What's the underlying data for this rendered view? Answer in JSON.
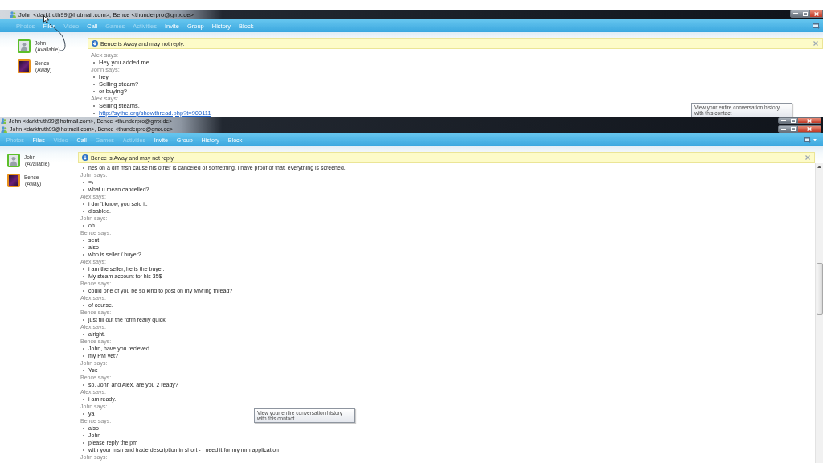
{
  "windows": [
    {
      "title": "John <darktruth99@hotmail.com>, Bence <thunderpro@gmx.de>",
      "toolbar": [
        {
          "label": "Photos",
          "disabled": true
        },
        {
          "label": "Files",
          "disabled": false
        },
        {
          "label": "Video",
          "disabled": true
        },
        {
          "label": "Call",
          "disabled": false
        },
        {
          "label": "Games",
          "disabled": true
        },
        {
          "label": "Activities",
          "disabled": true
        },
        {
          "label": "Invite",
          "disabled": false
        },
        {
          "label": "Group",
          "disabled": false
        },
        {
          "label": "History",
          "disabled": false
        },
        {
          "label": "Block",
          "disabled": false
        }
      ],
      "notice": "Bence is Away and may not reply.",
      "contacts": [
        {
          "name": "John",
          "status": "(Available)",
          "kind": "silhouette",
          "color": "#5cbf2a"
        },
        {
          "name": "Bence",
          "status": "(Away)",
          "kind": "photo",
          "color": "#e8901a"
        }
      ],
      "messages": [
        {
          "sender": "Alex says:",
          "lines": [
            "Hey you added me"
          ]
        },
        {
          "sender": "John says:",
          "lines": [
            "hey.",
            "Selling steam?",
            "or buying?"
          ]
        },
        {
          "sender": "Alex says:",
          "lines": [
            "Selling steams."
          ],
          "link": "http://sythe.org/showthread.php?t=900111"
        }
      ],
      "tooltip": "View your entire conversation history with this contact"
    },
    {
      "title": "John <darktruth99@hotmail.com>, Bence <thunderpro@gmx.de>"
    },
    {
      "title": "John <darktruth99@hotmail.com>, Bence <thunderpro@gmx.de>",
      "toolbar": [
        {
          "label": "Photos",
          "disabled": true
        },
        {
          "label": "Files",
          "disabled": false
        },
        {
          "label": "Video",
          "disabled": true
        },
        {
          "label": "Call",
          "disabled": false
        },
        {
          "label": "Games",
          "disabled": true
        },
        {
          "label": "Activities",
          "disabled": true
        },
        {
          "label": "Invite",
          "disabled": false
        },
        {
          "label": "Group",
          "disabled": false
        },
        {
          "label": "History",
          "disabled": false
        },
        {
          "label": "Block",
          "disabled": false
        }
      ],
      "menu_caret": true,
      "notice": "Bence is Away and may not reply.",
      "contacts": [
        {
          "name": "John",
          "status": "(Available)",
          "kind": "silhouette",
          "color": "#5cbf2a"
        },
        {
          "name": "Bence",
          "status": "(Away)",
          "kind": "photo",
          "color": "#e8901a"
        }
      ],
      "messages": [
        {
          "lines": [
            "hes on a diff msn cause his other is canceled or something, i have proof of that, everything is screened."
          ]
        },
        {
          "sender": "John says:",
          "lines": [
            "=\\",
            "what u mean cancelled?"
          ]
        },
        {
          "sender": "Alex says:",
          "lines": [
            "i don't know, you said it.",
            "disabled."
          ]
        },
        {
          "sender": "John says:",
          "lines": [
            "oh"
          ]
        },
        {
          "sender": "Bence says:",
          "lines": [
            "sent",
            "also",
            "who is seller / buyer?"
          ]
        },
        {
          "sender": "Alex says:",
          "lines": [
            "i am the seller, he is the buyer.",
            "My steam account for his 35$"
          ]
        },
        {
          "sender": "Bence says:",
          "lines": [
            "could one of you be so kind to post on my MM'ing thread?"
          ]
        },
        {
          "sender": "Alex says:",
          "lines": [
            "of course."
          ]
        },
        {
          "sender": "Bence says:",
          "lines": [
            "just fill out the form really quick"
          ]
        },
        {
          "sender": "Alex says:",
          "lines": [
            "alright."
          ]
        },
        {
          "sender": "Bence says:",
          "lines": [
            "John, have you recieved",
            "my PM yet?"
          ]
        },
        {
          "sender": "John says:",
          "lines": [
            "Yes"
          ]
        },
        {
          "sender": "Bence says:",
          "lines": [
            "so, John and Alex, are you 2 ready?"
          ]
        },
        {
          "sender": "Alex says:",
          "lines": [
            "i am ready."
          ]
        },
        {
          "sender": "John says:",
          "lines": [
            "ya"
          ]
        },
        {
          "sender": "Bence says:",
          "lines": [
            "also",
            "John",
            "please reply the pm",
            "with your msn and trade description in short - I need it for my mm application"
          ]
        },
        {
          "sender": "John says:"
        }
      ],
      "tooltip": "View your entire conversation history with this contact",
      "scrollbar": true
    }
  ]
}
